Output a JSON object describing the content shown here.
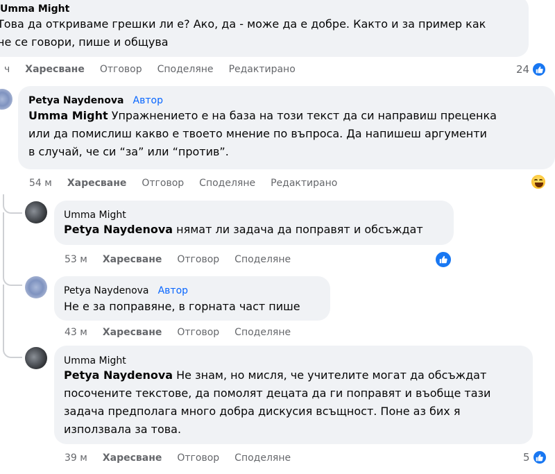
{
  "comments": [
    {
      "author": "Umma Might",
      "badge": "",
      "mention": "",
      "lines": [
        "Това да откриваме грешки ли е? Ако, да - може да е добре. Както и за пример как",
        "не се говори, пише и общува"
      ],
      "time": "ч",
      "like": "Харесване",
      "reply": "Отговор",
      "share": "Споделяне",
      "edited": "Редактирано",
      "reaction_count": "24",
      "reaction_type": "like-icon"
    },
    {
      "author": "Petya Naydenova",
      "badge": "Автор",
      "mention": "Umma Might",
      "lines": [
        " Упражнението е на база на този текст да си направиш преценка",
        "или да помислиш какво е твоето мнение по въпроса. Да напишеш аргументи",
        "в случай, че си “за” или “против”."
      ],
      "time": "54 м",
      "like": "Харесване",
      "reply": "Отговор",
      "share": "Споделяне",
      "edited": "Редактирано",
      "reaction_count": "",
      "reaction_type": "haha-icon"
    },
    {
      "author": "Umma Might",
      "badge": "",
      "mention": "Petya Naydenova",
      "lines": [
        " нямат ли задача да поправят и обсъждат"
      ],
      "time": "53 м",
      "like": "Харесване",
      "reply": "Отговор",
      "share": "Споделяне",
      "reaction_count": "",
      "reaction_type": "like-icon"
    },
    {
      "author": "Petya Naydenova",
      "badge": "Автор",
      "mention": "",
      "lines": [
        "Не е за поправяне, в горната част пише"
      ],
      "time": "43 м",
      "like": "Харесване",
      "reply": "Отговор",
      "share": "Споделяне"
    },
    {
      "author": "Umma Might",
      "badge": "",
      "mention": "Petya Naydenova",
      "lines": [
        " Не знам, но мисля, че учителите могат да обсъждат",
        "посочените текстове, да помолят децата да ги поправят и въобще тази",
        "задача предполага много добра дискусия всъщност. Поне аз бих я",
        "използвала за това."
      ],
      "time": "39 м",
      "like": "Харесване",
      "reply": "Отговор",
      "share": "Споделяне",
      "reaction_count": "5",
      "reaction_type": "like-icon"
    }
  ],
  "colors": {
    "bubble": "#f0f2f5",
    "meta": "#65676b",
    "author_badge": "#0866ff",
    "like": "#1877f2"
  }
}
